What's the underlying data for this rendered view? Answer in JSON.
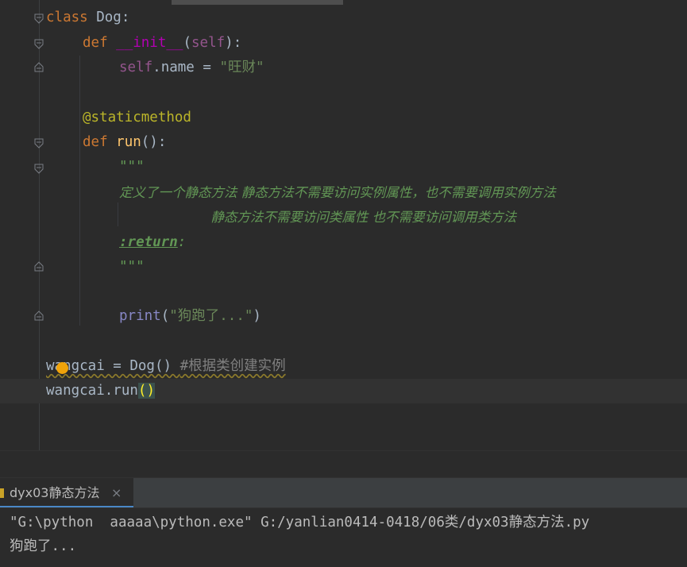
{
  "editor": {
    "lines": {
      "l1": {
        "kw": "class",
        "name": " Dog",
        "colon": ":"
      },
      "l2": {
        "kw": "def",
        "sp": " ",
        "fn": "__init__",
        "p1": "(",
        "self": "self",
        "p2": "):"
      },
      "l3": {
        "self": "self",
        "rest": ".name = ",
        "str": "\"旺财\""
      },
      "l5": {
        "deco": "@staticmethod"
      },
      "l6": {
        "kw": "def",
        "sp": " ",
        "fn": "run",
        "rest": "():"
      },
      "l7": {
        "doc": "\"\"\""
      },
      "l8": {
        "doc": "定义了一个静态方法 静态方法不需要访问实例属性，也不需要调用实例方法"
      },
      "l9": {
        "doc": "                      静态方法不需要访问类属性 也不需要访问调用类方法"
      },
      "l10": {
        "tag": ":return",
        "colon": ":"
      },
      "l11": {
        "doc": "\"\"\""
      },
      "l13": {
        "fn": "print",
        "p1": "(",
        "str": "\"狗跑了...\"",
        "p2": ")"
      },
      "l15": {
        "code": "wangcai = Dog() ",
        "comment": "#根据类创建实例"
      },
      "l16": {
        "code": "wangcai.run",
        "paren": "()"
      }
    }
  },
  "run_panel": {
    "tab_label": "dyx03静态方法",
    "close_icon": "×",
    "console": {
      "line1": "\"G:\\python  aaaaa\\python.exe\" G:/yanlian0414-0418/06类/dyx03静态方法.py",
      "line2": "狗跑了..."
    }
  }
}
